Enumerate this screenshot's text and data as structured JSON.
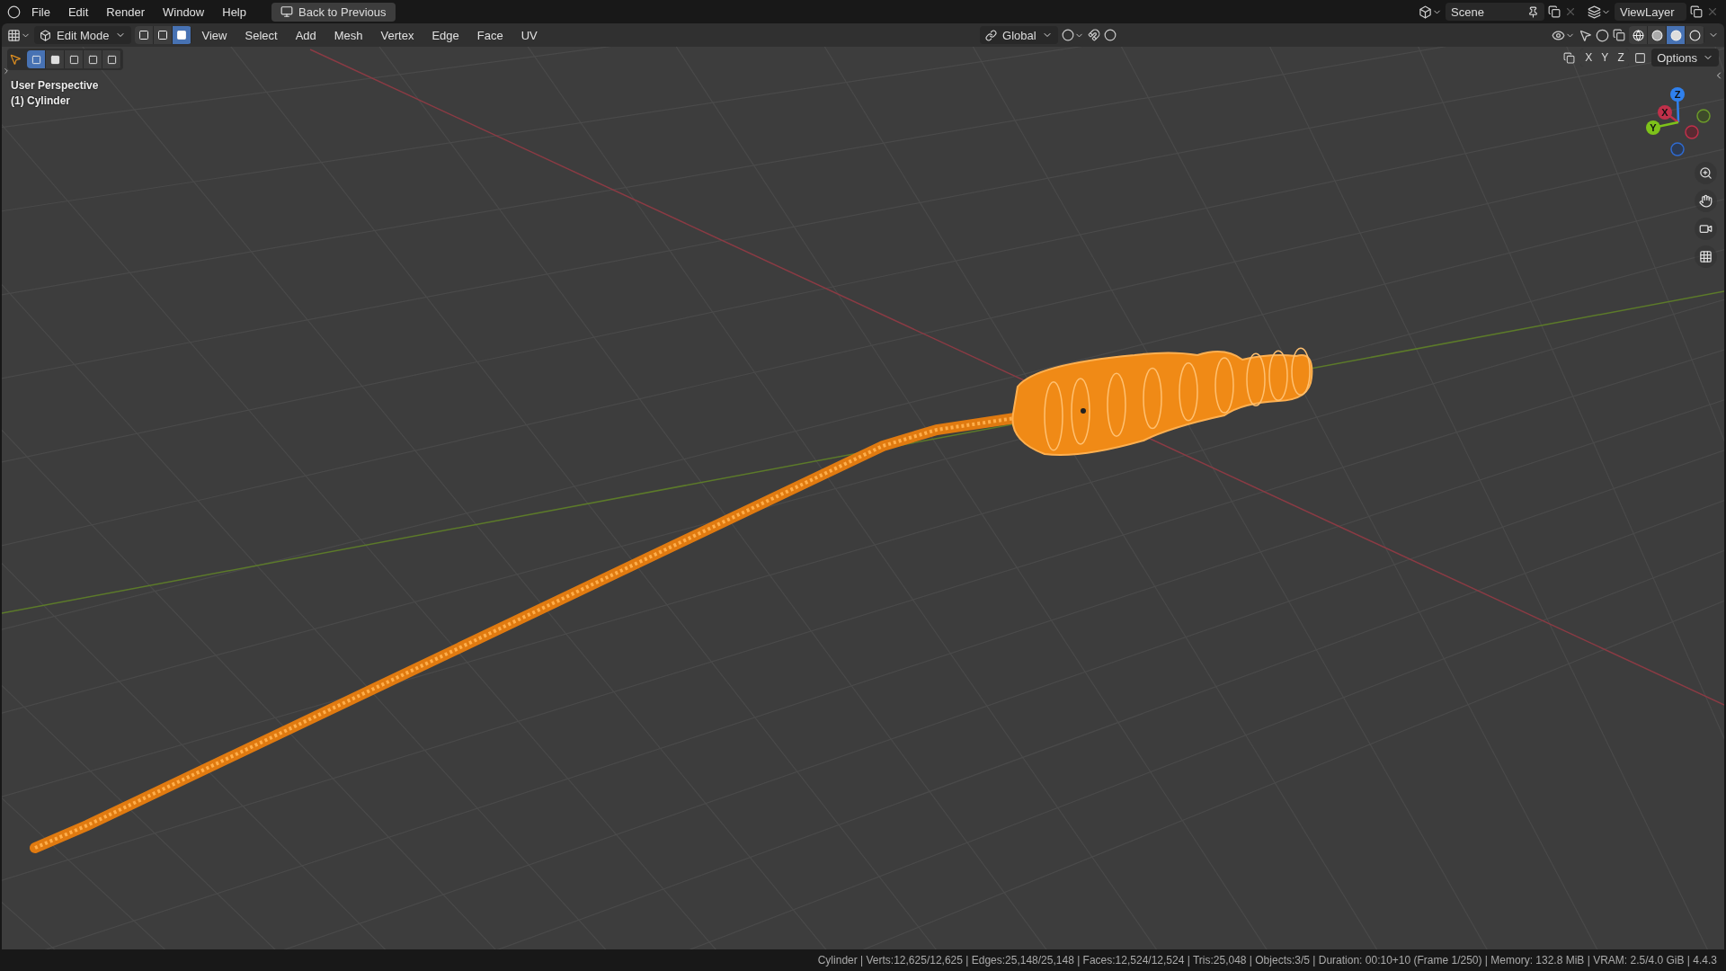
{
  "topbar": {
    "menus": [
      "File",
      "Edit",
      "Render",
      "Window",
      "Help"
    ],
    "back_button": "Back to Previous",
    "scene": "Scene",
    "view_layer": "ViewLayer"
  },
  "header": {
    "mode": "Edit Mode",
    "select_modes": [
      {
        "kind": "vertex",
        "selected": false
      },
      {
        "kind": "edge",
        "selected": false
      },
      {
        "kind": "face",
        "selected": true
      }
    ],
    "menus": [
      "View",
      "Select",
      "Add",
      "Mesh",
      "Vertex",
      "Edge",
      "Face",
      "UV"
    ],
    "orientation": "Global",
    "shading": [
      {
        "kind": "wireframe",
        "selected": false
      },
      {
        "kind": "solid",
        "selected": false
      },
      {
        "kind": "material",
        "selected": true
      },
      {
        "kind": "rendered",
        "selected": false
      }
    ]
  },
  "tool_row": {
    "box_modes": [
      {
        "kind": "new",
        "selected": true
      },
      {
        "kind": "extend",
        "selected": false
      },
      {
        "kind": "subtract",
        "selected": false
      },
      {
        "kind": "invert",
        "selected": false
      },
      {
        "kind": "intersect",
        "selected": false
      }
    ],
    "mirror_axes": [
      "X",
      "Y",
      "Z"
    ],
    "options": "Options"
  },
  "viewport": {
    "view_name": "User Perspective",
    "object_label": "(1) Cylinder"
  },
  "gizmo": {
    "axes": [
      {
        "label": "Z",
        "color": "#2f80ed"
      },
      {
        "label": "X",
        "color": "#c0304a"
      },
      {
        "label": "Y",
        "color": "#7ec21a"
      }
    ]
  },
  "status_bar": "Cylinder | Verts:12,625/12,625 | Edges:25,148/25,148 | Faces:12,524/12,524 | Tris:25,048 | Objects:3/5 | Duration: 00:10+10 (Frame 1/250) | Memory: 132.8 MiB | VRAM: 2.5/4.0 GiB | 4.4.3"
}
